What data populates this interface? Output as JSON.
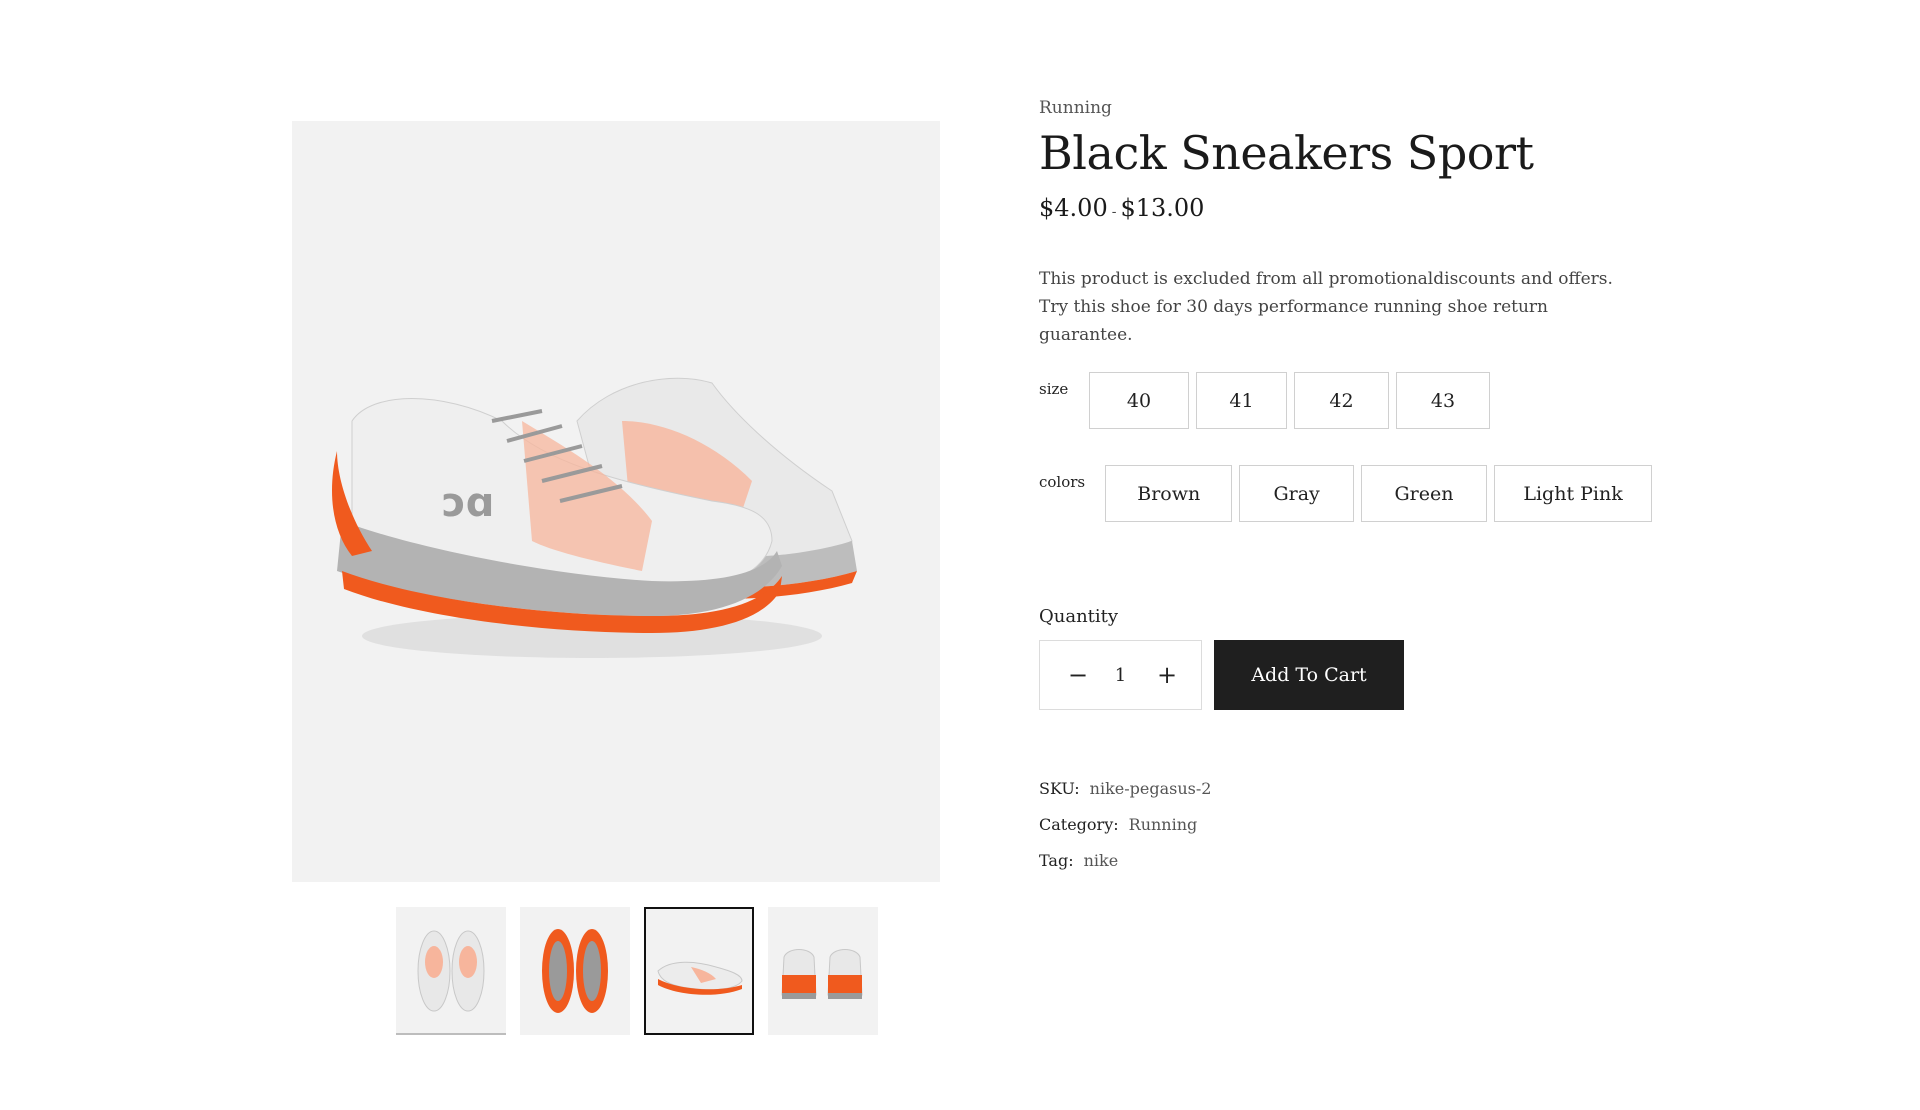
{
  "product": {
    "category_eyebrow": "Running",
    "title": "Black Sneakers Sport",
    "price_min": "$4.00",
    "price_sep": "-",
    "price_max": "$13.00",
    "description": "This product is excluded from all promotionaldiscounts and offers. Try this shoe for 30 days performance running shoe return guarantee."
  },
  "options": {
    "size_label": "size",
    "sizes": [
      "40",
      "41",
      "42",
      "43"
    ],
    "colors_label": "colors",
    "colors": [
      "Brown",
      "Gray",
      "Green",
      "Light Pink"
    ]
  },
  "cart": {
    "quantity_label": "Quantity",
    "minus": "−",
    "quantity": "1",
    "plus": "+",
    "add_to_cart": "Add To Cart"
  },
  "meta": {
    "sku_label": "SKU:",
    "sku": "nike-pegasus-2",
    "category_label": "Category:",
    "category": "Running",
    "tag_label": "Tag:",
    "tag": "nike"
  },
  "gallery": {
    "thumbnails": [
      "top-view",
      "sole-view",
      "side-view",
      "back-view"
    ],
    "active_thumbnail": 2
  },
  "colors": {
    "accent_orange": "#f05a1e",
    "button_dark": "#1f1f1f",
    "image_bg": "#f2f2f2"
  }
}
